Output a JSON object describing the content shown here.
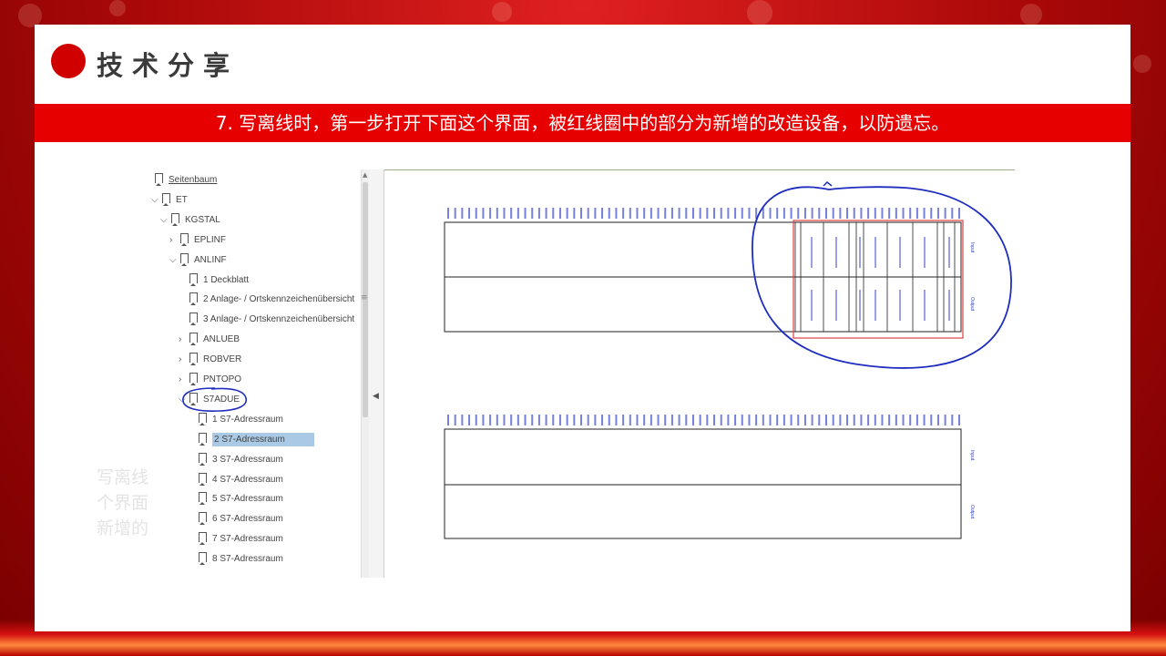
{
  "slide": {
    "title": "技术分享",
    "banner": "7. 写离线时，第一步打开下面这个界面，被红线圈中的部分为新增的改造设备，以防遗忘。",
    "ghost_lines": [
      "写离线",
      "个界面",
      "新增的"
    ]
  },
  "tree": {
    "items": [
      {
        "label": "Seitenbaum",
        "indent": 0,
        "chevron": "",
        "underline": true
      },
      {
        "label": "ET",
        "indent": 0,
        "chevron": "⌄"
      },
      {
        "label": "KGSTAL",
        "indent": 1,
        "chevron": "⌄"
      },
      {
        "label": "EPLINF",
        "indent": 2,
        "chevron": "›"
      },
      {
        "label": "ANLINF",
        "indent": 2,
        "chevron": "⌄"
      },
      {
        "label": "1 Deckblatt",
        "indent": 3,
        "chevron": ""
      },
      {
        "label": "2 Anlage- / Ortskennzeichenübersicht",
        "indent": 3,
        "chevron": ""
      },
      {
        "label": "3 Anlage- / Ortskennzeichenübersicht",
        "indent": 3,
        "chevron": ""
      },
      {
        "label": "ANLUEB",
        "indent": 3,
        "chevron": "›"
      },
      {
        "label": "ROBVER",
        "indent": 3,
        "chevron": "›"
      },
      {
        "label": "PNTOPO",
        "indent": 3,
        "chevron": "›"
      },
      {
        "label": "S7ADUE",
        "indent": 3,
        "chevron": "⌄",
        "circled": true
      },
      {
        "label": "1 S7-Adressraum",
        "indent": 4,
        "chevron": ""
      },
      {
        "label": "2 S7-Adressraum",
        "indent": 4,
        "chevron": "",
        "selected": true
      },
      {
        "label": "3 S7-Adressraum",
        "indent": 4,
        "chevron": ""
      },
      {
        "label": "4 S7-Adressraum",
        "indent": 4,
        "chevron": ""
      },
      {
        "label": "5 S7-Adressraum",
        "indent": 4,
        "chevron": ""
      },
      {
        "label": "6 S7-Adressraum",
        "indent": 4,
        "chevron": ""
      },
      {
        "label": "7 S7-Adressraum",
        "indent": 4,
        "chevron": ""
      },
      {
        "label": "8 S7-Adressraum",
        "indent": 4,
        "chevron": ""
      }
    ]
  },
  "diagram": {
    "panel1": {
      "row_labels": [
        "Input",
        "Output"
      ]
    },
    "panel2": {
      "row_labels": [
        "Input",
        "Output"
      ]
    }
  },
  "colors": {
    "accent_red": "#e60000",
    "annotation_blue": "#1e2dbf",
    "highlight_red": "#e04040"
  }
}
